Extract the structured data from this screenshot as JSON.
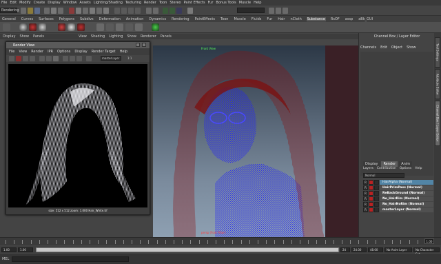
{
  "main_menu": [
    "File",
    "Edit",
    "Modify",
    "Create",
    "Display",
    "Window",
    "Assets",
    "Lighting/Shading",
    "Texturing",
    "Render",
    "Toon",
    "Stereo",
    "Paint Effects",
    "Fur",
    "Bonus Tools",
    "Muscle",
    "Help"
  ],
  "mode_select": "Rendering",
  "shelf_tabs": [
    "General",
    "Curves",
    "Surfaces",
    "Polygons",
    "Subdivs",
    "Deformation",
    "Animation",
    "Dynamics",
    "Rendering",
    "PaintEffects",
    "Toon",
    "Muscle",
    "Fluids",
    "Fur",
    "Hair",
    "nCloth",
    "Substance",
    "RsOF",
    "assp",
    "aBk_GUI"
  ],
  "shelf_active_tab": "Substance",
  "panel_menu": [
    "Display",
    "Show",
    "Panels",
    "View",
    "Shading",
    "Lighting",
    "Show",
    "Renderer",
    "Panels"
  ],
  "viewport": {
    "camera_label": "Front View",
    "bottom_label": "persp (Font Filter)"
  },
  "render_view": {
    "title": "Render View",
    "menu": [
      "File",
      "View",
      "Render",
      "IPR",
      "Options",
      "Display",
      "Render Target",
      "Help"
    ],
    "layer_select": "masterLayer",
    "zoom": "1:1",
    "caption": "size: 512 x 512 zoom: 1.000 Hair_White.tif"
  },
  "channel_box": {
    "title": "Channel Box / Layer Editor",
    "menu": [
      "Channels",
      "Edit",
      "Object",
      "Show"
    ]
  },
  "side_tabs": [
    "Tool Settings",
    "Attribute Editor",
    "Channel Box / Layer Editor"
  ],
  "layer_editor": {
    "tabs": [
      "Display",
      "Render",
      "Anim"
    ],
    "active_tab": "Render",
    "menu": [
      "Layers",
      "Contribution",
      "Options",
      "Help"
    ],
    "blend_mode": "Normal",
    "layers": [
      {
        "name": "HairAlpha (Normal)",
        "selected": true
      },
      {
        "name": "HairPrimPass (Normal)",
        "selected": false
      },
      {
        "name": "ReBackGround (Normal)",
        "selected": false
      },
      {
        "name": "No_HairRim (Normal)",
        "selected": false
      },
      {
        "name": "No_HairNoRim (Normal)",
        "selected": false
      },
      {
        "name": "masterLayer (Normal)",
        "selected": false
      }
    ]
  },
  "timeline": {
    "current_frame": "1.00",
    "range_start": "1.00",
    "playback_start": "1.00",
    "slider_value": "1",
    "range_end_1": "24",
    "end_time": "24.00",
    "end_time_2": "48.00",
    "anim_layer": "No Anim Layer",
    "char_set": "No Character Set"
  },
  "helpline": {
    "mel_label": "MEL"
  },
  "colors": {
    "render_layer_selected": "#5285a6",
    "layer_mark": "#b92323",
    "wire_hair": "#7a1212",
    "wire_body": "#1a1aff"
  }
}
